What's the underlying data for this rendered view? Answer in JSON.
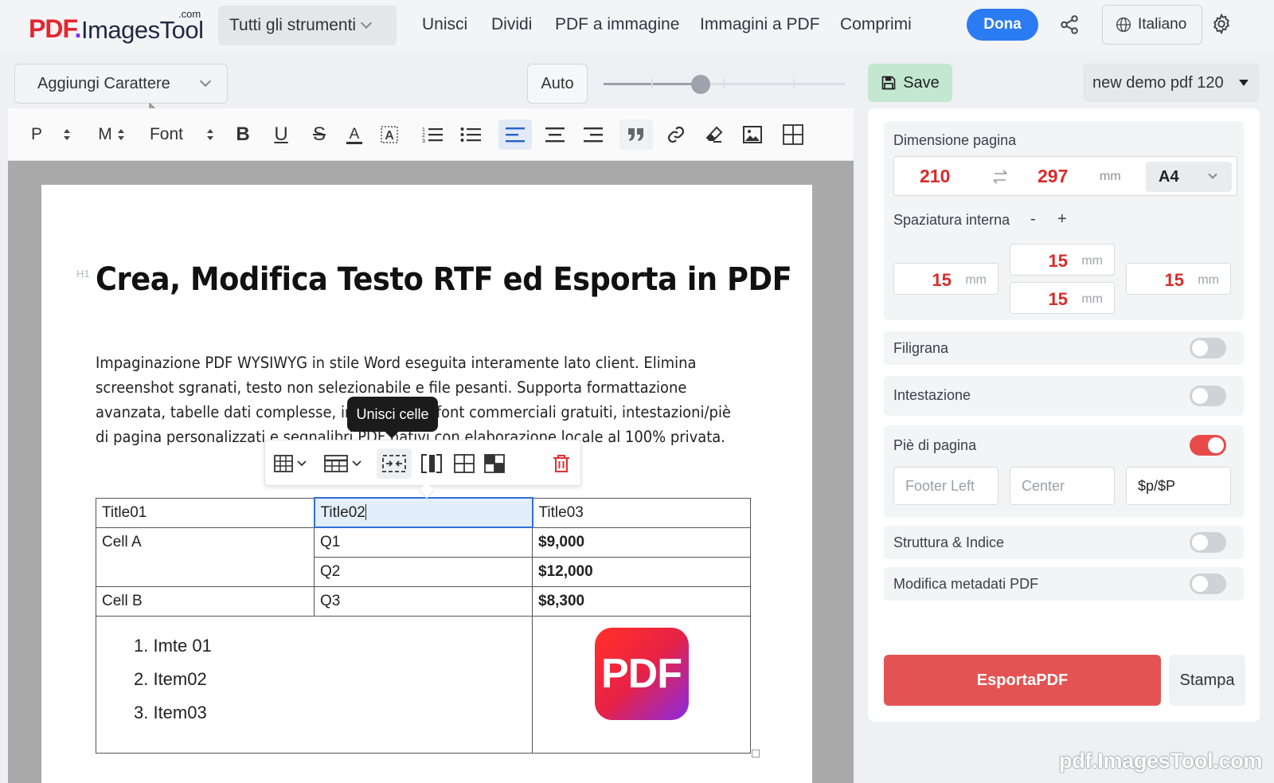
{
  "brand": {
    "logo_pdf": "PDF",
    "logo_dot": ".",
    "logo_name": "ImagesTool",
    "logo_tld": ".com"
  },
  "nav": {
    "tools_dropdown": "Tutti gli strumenti",
    "links": [
      "Unisci",
      "Dividi",
      "PDF a immagine",
      "Immagini a PDF",
      "Comprimi"
    ],
    "donate": "Dona",
    "language": "Italiano"
  },
  "editor": {
    "char_dropdown": "Aggiungi Carattere",
    "auto_button": "Auto",
    "zoom_level": 0.4,
    "toolbar": {
      "paragraph": "P",
      "size": "M",
      "font": "Font",
      "bold": "B",
      "underline": "U",
      "strike": "S",
      "text_color": "A"
    }
  },
  "document": {
    "heading_tag": "H1",
    "title": "Crea, Modifica Testo RTF ed Esporta in PDF",
    "paragraph": "Impaginazione PDF WYSIWYG in stile Word eseguita interamente lato client. Elimina screenshot sgranati, testo non selezionabile e file pesanti. Supporta formattazione avanzata, tabelle dati complesse, inclusi molto font commerciali gratuiti, intestazioni/piè di pagina personalizzati e segnalibri PDF nativi con elaborazione locale al 100% privata.",
    "table": {
      "headers": [
        "Title01",
        "Title02",
        "Title03"
      ],
      "rows": [
        [
          "Cell A",
          "Q1",
          "$9,000"
        ],
        [
          "",
          "Q2",
          "$12,000"
        ],
        [
          "Cell B",
          "Q3",
          "$8,300"
        ]
      ],
      "list_items": [
        "1. Imte 01",
        "2. Item02",
        "3. Item03"
      ],
      "image_label": "PDF"
    },
    "tooltip": "Unisci celle"
  },
  "panel": {
    "save": "Save",
    "document_name": "new demo pdf 120",
    "page_size_label": "Dimensione pagina",
    "width": "210",
    "height": "297",
    "unit": "mm",
    "paper": "A4",
    "padding_label": "Spaziatura interna",
    "padding_minus": "-",
    "padding_plus": "+",
    "padding": {
      "top": "15",
      "left": "15",
      "right": "15",
      "bottom": "15"
    },
    "watermark_label": "Filigrana",
    "header_label": "Intestazione",
    "footer_label": "Piè di pagina",
    "footer_left": "Footer Left",
    "footer_center": "Center",
    "footer_right": "$p/$P",
    "outline_label": "Struttura & Indice",
    "metadata_label": "Modifica metadati PDF",
    "export": "EsportaPDF",
    "print": "Stampa"
  },
  "watermark_text": "pdf.ImagesTool.com"
}
